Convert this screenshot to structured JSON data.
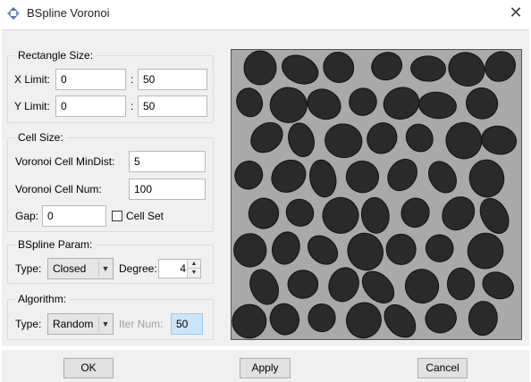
{
  "window": {
    "title": "BSpline Voronoi",
    "icon": "diamond-arrows-icon",
    "close_glyph": "✕"
  },
  "rectangle_size": {
    "legend": "Rectangle Size:",
    "x_label": "X Limit:",
    "x_min": "0",
    "x_max": "50",
    "y_label": "Y Limit:",
    "y_min": "0",
    "y_max": "50",
    "separator": ":"
  },
  "cell_size": {
    "legend": "Cell Size:",
    "mindist_label": "Voronoi Cell MinDist:",
    "mindist_value": "5",
    "num_label": "Voronoi Cell Num:",
    "num_value": "100",
    "gap_label": "Gap:",
    "gap_value": "0",
    "cellset_label": "Cell Set",
    "cellset_checked": false
  },
  "bspline_param": {
    "legend": "BSpline Param:",
    "type_label": "Type:",
    "type_value": "Closed",
    "degree_label": "Degree:",
    "degree_value": "4"
  },
  "algorithm": {
    "legend": "Algorithm:",
    "type_label": "Type:",
    "type_value": "Random",
    "iter_label": "Iter Num:",
    "iter_value": "50"
  },
  "buttons": {
    "ok": "OK",
    "apply": "Apply",
    "cancel": "Cancel"
  },
  "colors": {
    "cell": "#2a2a2a",
    "cell_stroke": "#111111",
    "preview_bg": "#a9a9a9"
  }
}
